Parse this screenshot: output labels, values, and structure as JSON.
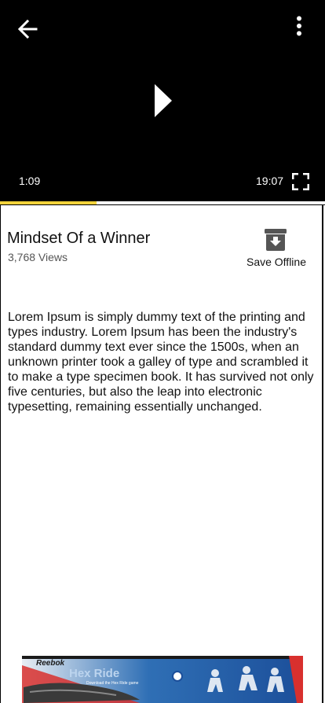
{
  "player": {
    "current_time": "1:09",
    "total_time": "19:07",
    "progress_fraction": 0.298,
    "progress_color": "#f2d33b"
  },
  "video": {
    "title": "Mindset Of a Winner",
    "views": "3,768 Views",
    "save_offline_label": "Save Offline",
    "description": "Lorem Ipsum is simply dummy text of the printing and types industry. Lorem Ipsum has been the industry's standard dummy text ever since the 1500s, when an unknown printer took a galley of type and scrambled it to make a type specimen book. It has survived not only five centuries, but also the leap into electronic typesetting, remaining essentially unchanged."
  },
  "ad": {
    "brand": "Reebok",
    "product": "Hex Ride",
    "tagline": "Download the Hex Ride game"
  },
  "icons": {
    "back": "arrow-left-icon",
    "more": "more-vertical-icon",
    "play": "play-icon",
    "fullscreen": "fullscreen-icon",
    "save": "archive-download-icon"
  }
}
